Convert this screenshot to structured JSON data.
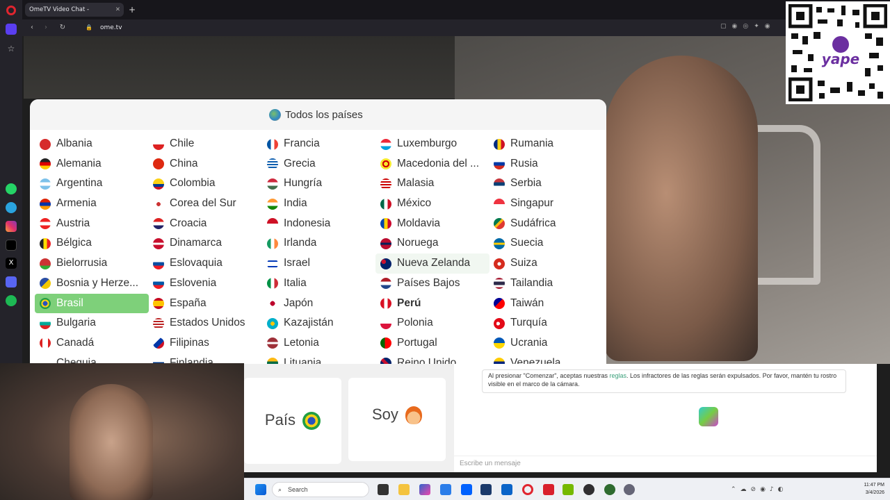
{
  "browser": {
    "tab_title": "OmeTV Video Chat -",
    "url": "ome.tv",
    "sidebar_icons": [
      "opera-logo-icon",
      "home-icon",
      "star-icon",
      "whatsapp-icon",
      "telegram-icon",
      "instagram-icon",
      "tiktok-icon",
      "x-icon",
      "discord-icon",
      "spotify-icon"
    ]
  },
  "modal": {
    "title": "Todos los países",
    "columns": [
      [
        "Albania",
        "Alemania",
        "Argentina",
        "Armenia",
        "Austria",
        "Bélgica",
        "Bielorrusia",
        "Bosnia y Herze...",
        "Brasil",
        "Bulgaria",
        "Canadá",
        "Chequia"
      ],
      [
        "Chile",
        "China",
        "Colombia",
        "Corea del Sur",
        "Croacia",
        "Dinamarca",
        "Eslovaquia",
        "Eslovenia",
        "España",
        "Estados Unidos",
        "Filipinas",
        "Finlandia"
      ],
      [
        "Francia",
        "Grecia",
        "Hungría",
        "India",
        "Indonesia",
        "Irlanda",
        "Israel",
        "Italia",
        "Japón",
        "Kazajistán",
        "Letonia",
        "Lituania"
      ],
      [
        "Luxemburgo",
        "Macedonia del ...",
        "Malasia",
        "México",
        "Moldavia",
        "Noruega",
        "Nueva Zelanda",
        "Países Bajos",
        "Perú",
        "Polonia",
        "Portugal",
        "Reino Unido"
      ],
      [
        "Rumania",
        "Rusia",
        "Serbia",
        "Singapur",
        "Sudáfrica",
        "Suecia",
        "Suiza",
        "Tailandia",
        "Taiwán",
        "Turquía",
        "Ucrania",
        "Venezuela"
      ]
    ],
    "selected": "Brasil",
    "hovered": "Nueva Zelanda",
    "bold": "Perú"
  },
  "controls": {
    "country_label": "País",
    "gender_label": "Soy"
  },
  "chat": {
    "notice_prefix": "Al presionar \"Comenzar\", aceptas nuestras ",
    "notice_link": "reglas",
    "notice_suffix": ". Los infractores de las reglas serán expulsados. Por favor, mantén tu rostro visible en el marco de la cámara.",
    "placeholder": "Escribe un mensaje"
  },
  "taskbar": {
    "search_placeholder": "Search",
    "time": "11:47 PM",
    "date": "3/4/2026"
  },
  "qr": {
    "brand": "yape"
  }
}
